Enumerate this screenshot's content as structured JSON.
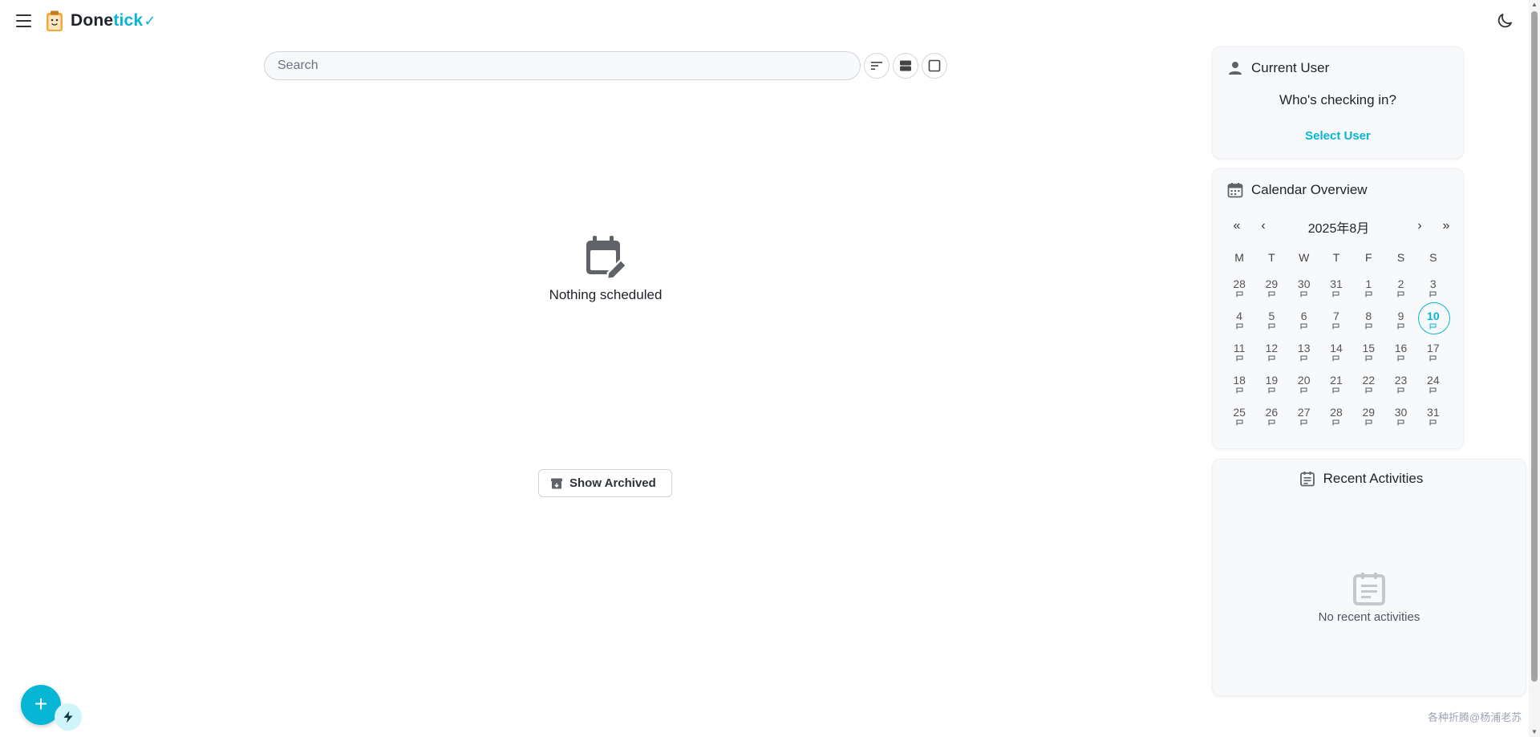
{
  "header": {
    "brand_part1": "Done",
    "brand_part2": "tick",
    "brand_check": "✓",
    "menu_icon": "hamburger-menu-icon",
    "theme_icon": "moon-icon"
  },
  "search": {
    "placeholder": "Search",
    "value": ""
  },
  "toolbar": {
    "sort_icon": "sort-icon",
    "compact_view_icon": "stacked-view-icon",
    "select_icon": "square-select-icon"
  },
  "main": {
    "empty_text": "Nothing scheduled",
    "show_archived_label": "Show Archived"
  },
  "current_user": {
    "title": "Current User",
    "prompt": "Who's checking in?",
    "select_label": "Select User"
  },
  "calendar": {
    "title": "Calendar Overview",
    "month_label": "2025年8月",
    "nav": {
      "prev_year": "«",
      "prev_month": "‹",
      "next_month": "›",
      "next_year": "»"
    },
    "weekdays": [
      "M",
      "T",
      "W",
      "T",
      "F",
      "S",
      "S"
    ],
    "weeks": [
      [
        "28",
        "29",
        "30",
        "31",
        "1",
        "2",
        "3"
      ],
      [
        "4",
        "5",
        "6",
        "7",
        "8",
        "9",
        "10"
      ],
      [
        "11",
        "12",
        "13",
        "14",
        "15",
        "16",
        "17"
      ],
      [
        "18",
        "19",
        "20",
        "21",
        "22",
        "23",
        "24"
      ],
      [
        "25",
        "26",
        "27",
        "28",
        "29",
        "30",
        "31"
      ]
    ],
    "today": "10"
  },
  "activities": {
    "title": "Recent Activities",
    "empty_text": "No recent activities"
  },
  "fab": {
    "add_label": "+",
    "quick_icon": "lightning-icon"
  },
  "watermark": "各种折腾@杨浦老苏",
  "colors": {
    "accent": "#06b6d4",
    "text": "#1f2329",
    "icon": "#5f6368"
  }
}
